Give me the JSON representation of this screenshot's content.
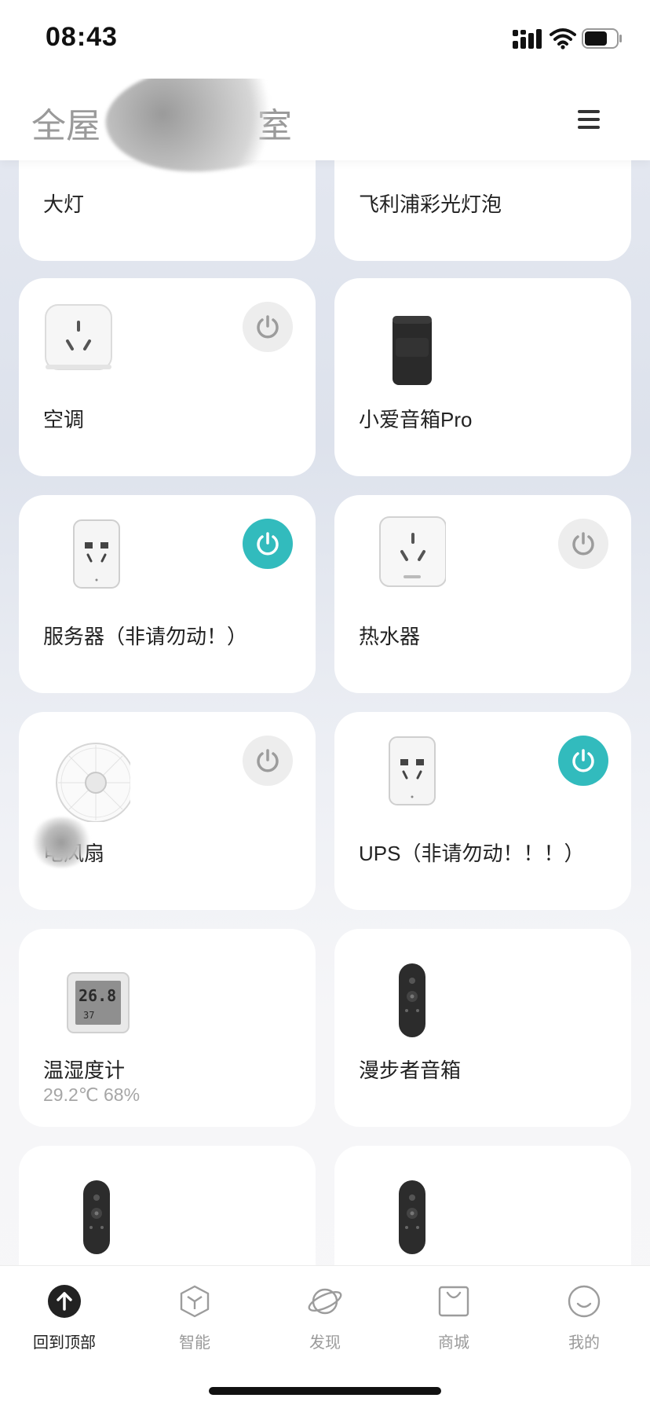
{
  "status_bar": {
    "time": "08:43"
  },
  "header": {
    "title_prefix": "全屋",
    "title_suffix": "室"
  },
  "devices": [
    {
      "name": "大灯",
      "status": ""
    },
    {
      "name": "飞利浦彩光灯泡",
      "status": ""
    },
    {
      "name": "空调",
      "status": "",
      "power": "off"
    },
    {
      "name": "小爱音箱Pro",
      "status": ""
    },
    {
      "name": "服务器（非请勿动！）",
      "status": "",
      "power": "on"
    },
    {
      "name": "热水器",
      "status": "",
      "power": "off"
    },
    {
      "name": "电风扇",
      "status": "",
      "power": "off"
    },
    {
      "name": "UPS（非请勿动！！！）",
      "status": "",
      "power": "on"
    },
    {
      "name": "温湿度计",
      "status": "29.2℃ 68%",
      "display_temp": "26.8",
      "display_hum": "37"
    },
    {
      "name": "漫步者音箱",
      "status": ""
    },
    {
      "name": "",
      "status": ""
    },
    {
      "name": "",
      "status": ""
    }
  ],
  "tabbar": {
    "items": [
      {
        "label": "回到顶部",
        "icon": "arrow-up-icon",
        "active": true
      },
      {
        "label": "智能",
        "icon": "cube-icon",
        "active": false
      },
      {
        "label": "发现",
        "icon": "planet-icon",
        "active": false
      },
      {
        "label": "商城",
        "icon": "bag-icon",
        "active": false
      },
      {
        "label": "我的",
        "icon": "smile-icon",
        "active": false
      }
    ]
  },
  "colors": {
    "accent": "#32bbbd",
    "power_off_bg": "#ededed",
    "power_off_icon": "#9c9c9c"
  }
}
